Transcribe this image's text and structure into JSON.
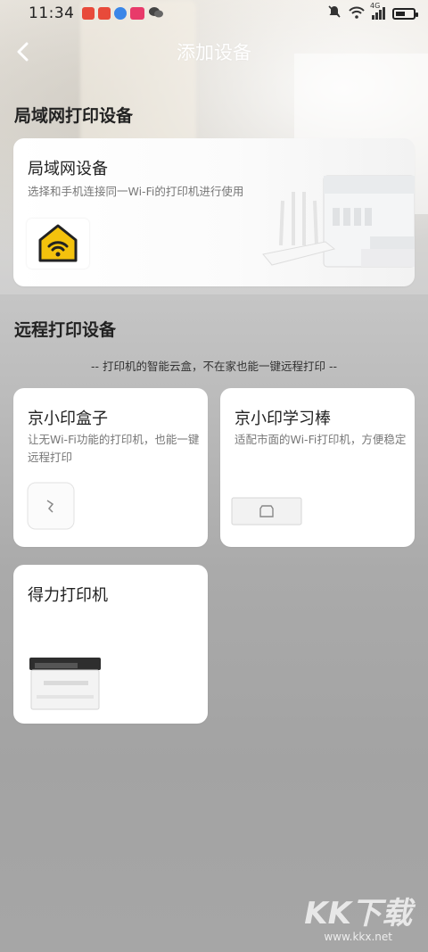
{
  "status_bar": {
    "time": "11:34",
    "network": "4G",
    "app_badge_colors": [
      "#e84a3a",
      "#e84a3a",
      "#3a86e8",
      "#e83a6a"
    ],
    "icons": [
      "bell-mute-icon",
      "wifi-icon",
      "signal-icon",
      "battery-icon"
    ],
    "battery_level": 0.55
  },
  "nav": {
    "back_icon": "chevron-left-icon",
    "title": "添加设备"
  },
  "lan_section": {
    "title": "局域网打印设备",
    "card": {
      "title": "局域网设备",
      "desc": "选择和手机连接同一Wi-Fi的打印机进行使用",
      "icon": "home-wifi-icon",
      "icon_color": "#f4c20d"
    }
  },
  "remote_section": {
    "title": "远程打印设备",
    "subtitle": "-- 打印机的智能云盒，不在家也能一键远程打印 --",
    "cards": [
      {
        "title": "京小印盒子",
        "desc": "让无Wi-Fi功能的打印机，也能一键远程打印",
        "image": "cloud-box-device"
      },
      {
        "title": "京小印学习棒",
        "desc": "适配市面的Wi-Fi打印机，方便稳定",
        "image": "study-stick-device"
      },
      {
        "title": "得力打印机",
        "desc": "",
        "image": "laser-printer"
      }
    ]
  },
  "watermark": {
    "text": "KK下载",
    "url": "www.kkx.net"
  }
}
